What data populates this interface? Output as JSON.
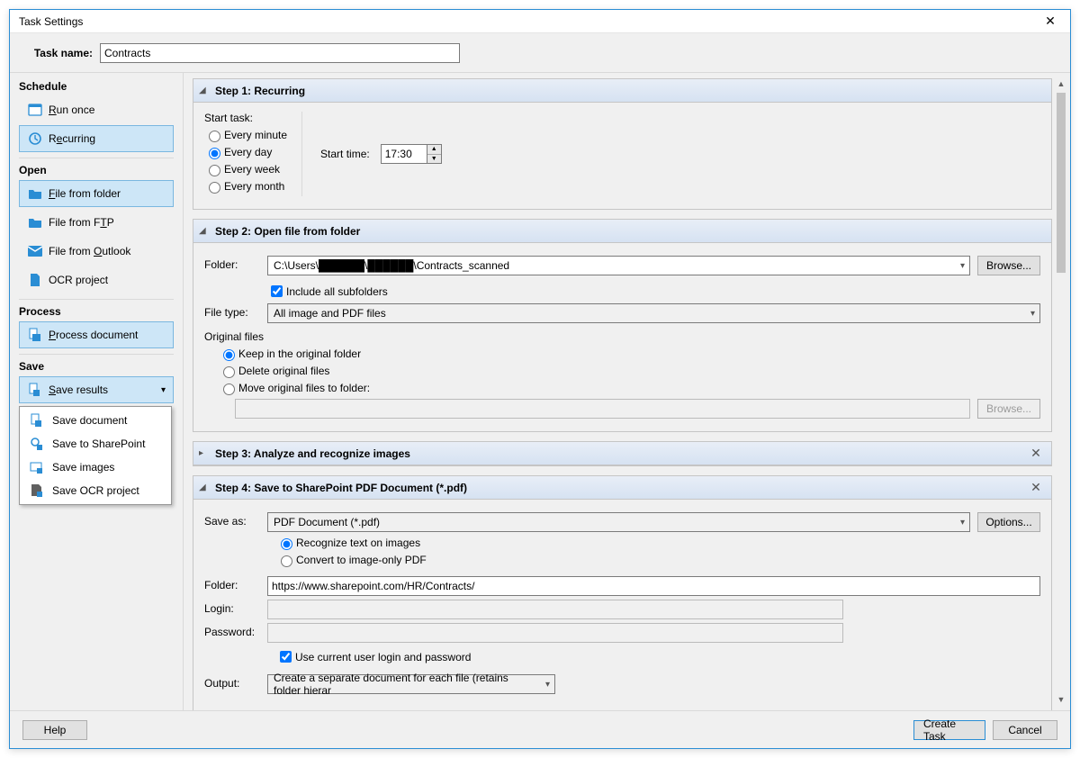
{
  "window": {
    "title": "Task Settings"
  },
  "taskName": {
    "label": "Task name:",
    "value": "Contracts"
  },
  "sidebar": {
    "sections": {
      "schedule": {
        "title": "Schedule",
        "runOnce": "Run once",
        "recurring": "Recurring"
      },
      "open": {
        "title": "Open",
        "fileFromFolder": "File from folder",
        "fileFromFTP": "File from FTP",
        "fileFromOutlook": "File from Outlook",
        "ocrProject": "OCR project"
      },
      "process": {
        "title": "Process",
        "processDocument": "Process document"
      },
      "save": {
        "title": "Save",
        "saveResults": "Save results"
      }
    }
  },
  "saveMenu": {
    "saveDocument": "Save document",
    "saveToSharepoint": "Save to SharePoint",
    "saveImages": "Save images",
    "saveOCRProject": "Save OCR project"
  },
  "step1": {
    "title": "Step 1: Recurring",
    "startTask": "Start task:",
    "opts": {
      "minute": "Every minute",
      "day": "Every day",
      "week": "Every week",
      "month": "Every month"
    },
    "startTimeLbl": "Start time:",
    "startTime": "17:30"
  },
  "step2": {
    "title": "Step 2: Open file from folder",
    "folderLbl": "Folder:",
    "folderValue": "C:\\Users\\██████\\██████\\Contracts_scanned",
    "browse": "Browse...",
    "includeSub": "Include all subfolders",
    "fileTypeLbl": "File type:",
    "fileTypeValue": "All image and PDF files",
    "origFilesLbl": "Original files",
    "keep": "Keep in the original folder",
    "delete": "Delete original files",
    "move": "Move original files to folder:",
    "browse2": "Browse..."
  },
  "step3": {
    "title": "Step 3: Analyze and recognize images"
  },
  "step4": {
    "title": "Step 4: Save to SharePoint PDF Document (*.pdf)",
    "saveAsLbl": "Save as:",
    "saveAsValue": "PDF Document (*.pdf)",
    "optionsBtn": "Options...",
    "recognize": "Recognize text on images",
    "convert": "Convert to image-only PDF",
    "folderLbl": "Folder:",
    "folderValue": "https://www.sharepoint.com/HR/Contracts/",
    "loginLbl": "Login:",
    "passwordLbl": "Password:",
    "useCurrent": "Use current user login and password",
    "outputLbl": "Output:",
    "outputValue": "Create a separate document for each file (retains folder hierar"
  },
  "footer": {
    "help": "Help",
    "create": "Create Task",
    "cancel": "Cancel"
  }
}
